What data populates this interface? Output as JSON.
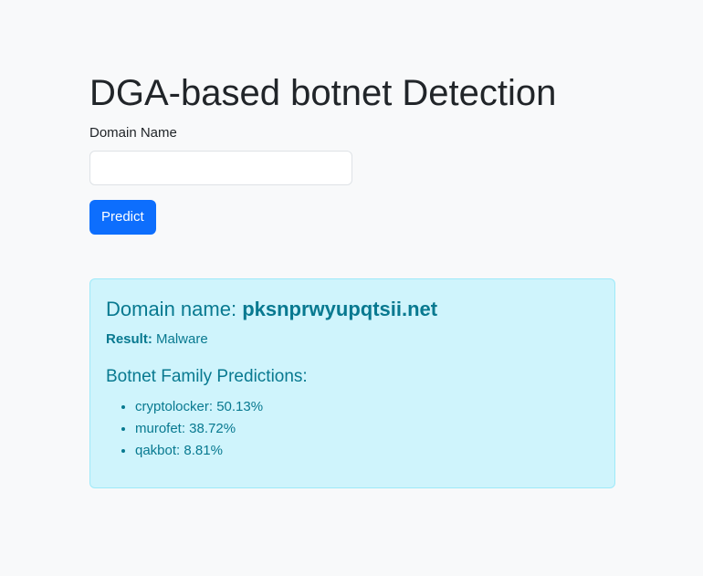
{
  "page": {
    "title": "DGA-based botnet Detection"
  },
  "form": {
    "label": "Domain Name",
    "input_value": "",
    "input_placeholder": "",
    "button_label": "Predict"
  },
  "result": {
    "domain_prefix": "Domain name: ",
    "domain": "pksnprwyupqtsii.net",
    "result_label": "Result:",
    "result_value": "Malware",
    "family_heading": "Botnet Family Predictions:",
    "families": [
      {
        "text": "cryptolocker: 50.13%"
      },
      {
        "text": "murofet: 38.72%"
      },
      {
        "text": "qakbot: 8.81%"
      }
    ],
    "colors": {
      "alert_bg": "#cff4fc",
      "alert_border": "#9eeaf9",
      "alert_text": "#087990",
      "button_bg": "#0d6efd"
    }
  }
}
